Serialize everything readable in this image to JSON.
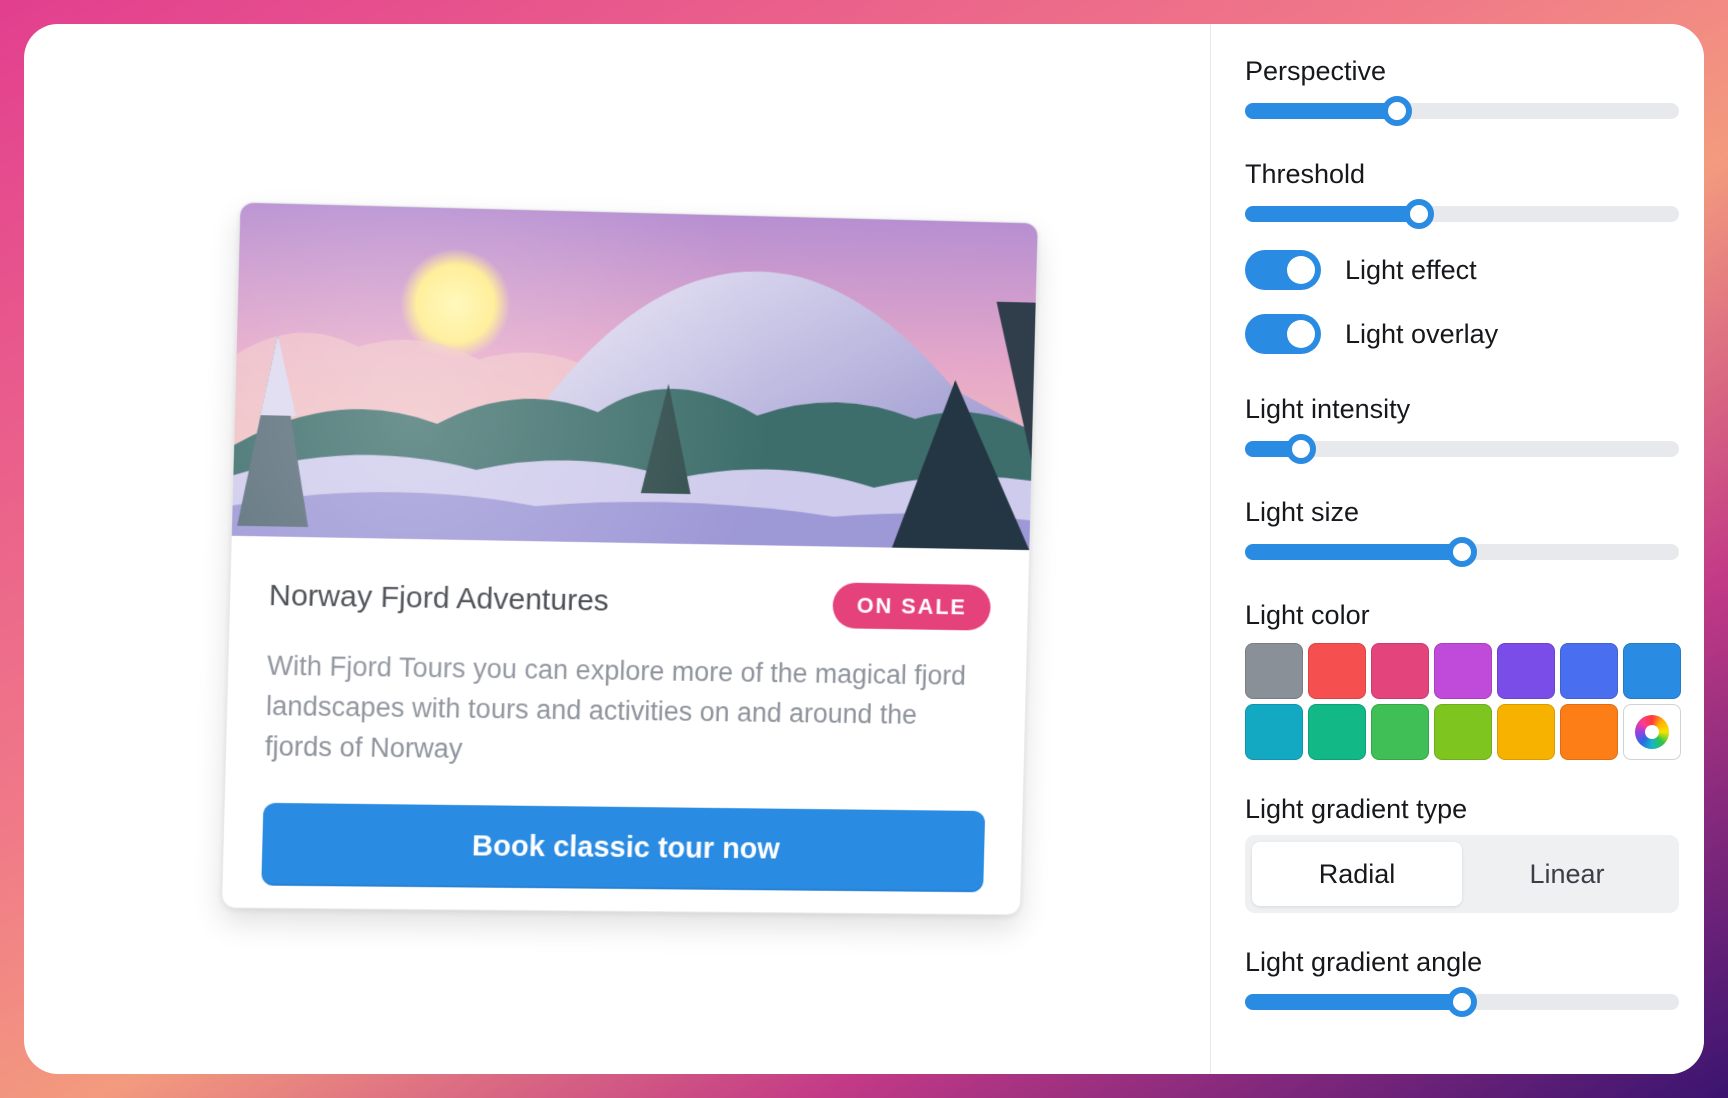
{
  "card": {
    "title": "Norway Fjord Adventures",
    "badge": "ON SALE",
    "description": "With Fjord Tours you can explore more of the magical fjord landscapes with tours and activities on and around the fjords of Norway",
    "cta": "Book classic tour now",
    "badge_color": "#e5417b",
    "cta_color": "#2a8be2"
  },
  "controls": {
    "perspective": {
      "label": "Perspective",
      "value": 0.35
    },
    "threshold": {
      "label": "Threshold",
      "value": 0.4
    },
    "light_effect": {
      "label": "Light effect",
      "on": true
    },
    "light_overlay": {
      "label": "Light overlay",
      "on": true
    },
    "light_intensity": {
      "label": "Light intensity",
      "value": 0.13
    },
    "light_size": {
      "label": "Light size",
      "value": 0.5
    },
    "light_color": {
      "label": "Light color",
      "swatches": [
        "#8a9097",
        "#f64f4f",
        "#e4447c",
        "#c04ad9",
        "#7b4de8",
        "#4a6ef0",
        "#2a8be2",
        "#14a9c3",
        "#12b886",
        "#3fbf55",
        "#7ec51f",
        "#f7b200",
        "#fd7d16"
      ],
      "picker_icon": "color-wheel-icon"
    },
    "gradient_type": {
      "label": "Light gradient type",
      "options": [
        "Radial",
        "Linear"
      ],
      "selected": "Radial"
    },
    "gradient_angle": {
      "label": "Light gradient angle",
      "value": 0.5
    }
  },
  "accent_color": "#2a8be2"
}
